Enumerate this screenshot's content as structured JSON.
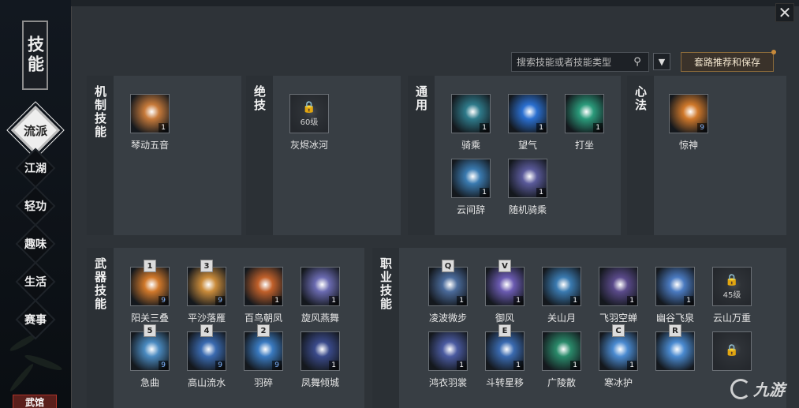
{
  "window": {
    "title": "技能",
    "close_label": "✕"
  },
  "nav": {
    "items": [
      {
        "label": "流派",
        "active": true
      },
      {
        "label": "江湖",
        "active": false
      },
      {
        "label": "轻功",
        "active": false
      },
      {
        "label": "趣味",
        "active": false
      },
      {
        "label": "生活",
        "active": false
      },
      {
        "label": "赛事",
        "active": false
      }
    ],
    "bottom_label": "武馆"
  },
  "toolbar": {
    "search_placeholder": "搜索技能或者技能类型",
    "search_icon": "search-icon",
    "filter_icon": "filter-icon",
    "route_button": "套路推荐和保存"
  },
  "sections": {
    "mechanism": {
      "title": "机制技能",
      "skills": [
        {
          "name": "琴动五音",
          "count": "1",
          "color": "#c77a3a"
        }
      ]
    },
    "ultimate": {
      "title": "绝技",
      "skills": [
        {
          "name": "灰烬冰河",
          "locked": true,
          "level": "60级",
          "color": "#555a60"
        }
      ]
    },
    "common": {
      "title": "通用",
      "skills": [
        {
          "name": "骑乘",
          "count": "1",
          "color": "#2e7a8a"
        },
        {
          "name": "望气",
          "count": "1",
          "color": "#2a6fd0"
        },
        {
          "name": "打坐",
          "count": "1",
          "color": "#2a9a7a"
        },
        {
          "name": "云间辞",
          "count": "1",
          "color": "#3a7ab0"
        },
        {
          "name": "随机骑乘",
          "count": "1",
          "color": "#5a5a9a"
        }
      ]
    },
    "heart": {
      "title": "心法",
      "skills": [
        {
          "name": "惊神",
          "count": "9",
          "count_blue": true,
          "color": "#d0782a"
        }
      ]
    },
    "weapon": {
      "title": "武器技能",
      "skills": [
        {
          "name": "阳关三叠",
          "key": "1",
          "count": "9",
          "count_blue": true,
          "color": "#d0782a"
        },
        {
          "name": "平沙落雁",
          "key": "3",
          "count": "9",
          "count_blue": true,
          "color": "#c88a3a"
        },
        {
          "name": "百鸟朝凤",
          "count": "1",
          "color": "#c0602a"
        },
        {
          "name": "旋风燕舞",
          "count": "1",
          "color": "#6a6ab0"
        },
        {
          "name": "急曲",
          "key": "5",
          "count": "9",
          "count_blue": true,
          "color": "#4a8ac0"
        },
        {
          "name": "高山流水",
          "key": "4",
          "count": "9",
          "count_blue": true,
          "color": "#3a6ab0"
        },
        {
          "name": "羽碎",
          "key": "2",
          "count": "9",
          "count_blue": true,
          "color": "#3a7ac0"
        },
        {
          "name": "凤舞倾城",
          "count": "1",
          "color": "#3a4a8a"
        }
      ]
    },
    "profession": {
      "title": "职业技能",
      "skills": [
        {
          "name": "凌波微步",
          "key": "Q",
          "count": "1",
          "color": "#4a6a9a"
        },
        {
          "name": "御风",
          "key": "V",
          "count": "1",
          "color": "#6a5ab0"
        },
        {
          "name": "关山月",
          "count": "1",
          "color": "#3a7ab0"
        },
        {
          "name": "飞羽空蝉",
          "count": "1",
          "color": "#5a4a8a"
        },
        {
          "name": "幽谷飞泉",
          "count": "1",
          "color": "#4a7ac0"
        },
        {
          "name": "云山万重",
          "locked": true,
          "level": "45级",
          "color": "#555a60"
        },
        {
          "name": "鸿衣羽裳",
          "count": "1",
          "color": "#4a5aa0"
        },
        {
          "name": "斗转星移",
          "key": "E",
          "count": "1",
          "color": "#3a6ab0"
        },
        {
          "name": "广陵散",
          "count": "1",
          "color": "#2a8a6a"
        },
        {
          "name": "寒冰护",
          "key": "C",
          "count": "1",
          "color": "#4a8ad0"
        },
        {
          "name": "",
          "key": "R",
          "count": "",
          "color": "#4a8ad0"
        },
        {
          "name": "",
          "locked": true,
          "level": "",
          "color": "#555a60"
        }
      ]
    }
  },
  "watermark": {
    "text": "九游"
  }
}
